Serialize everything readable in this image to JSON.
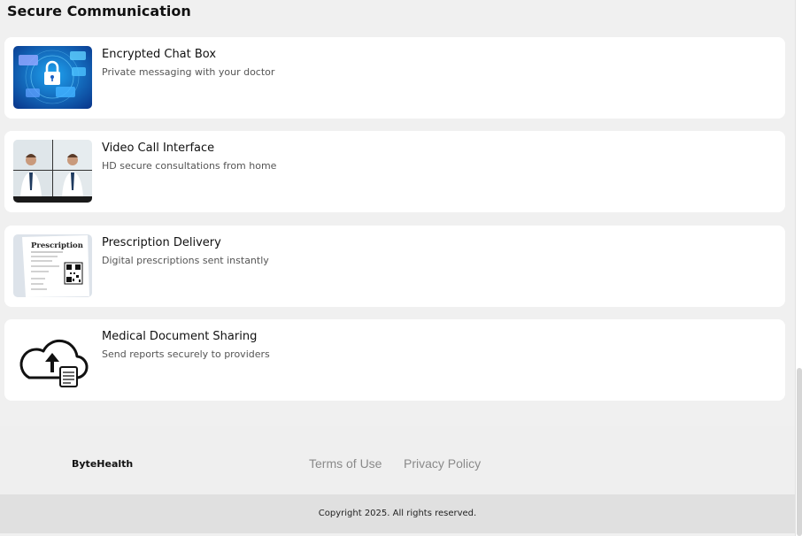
{
  "section": {
    "title": "Secure Communication"
  },
  "cards": [
    {
      "title": "Encrypted Chat Box",
      "description": "Private messaging with your doctor",
      "icon": "encrypted-chat-image"
    },
    {
      "title": "Video Call Interface",
      "description": "HD secure consultations from home",
      "icon": "video-call-image"
    },
    {
      "title": "Prescription Delivery",
      "description": "Digital prescriptions sent instantly",
      "icon": "prescription-image"
    },
    {
      "title": "Medical Document Sharing",
      "description": "Send reports securely to providers",
      "icon": "cloud-upload-icon"
    }
  ],
  "thumb_labels": {
    "prescription": "Prescription"
  },
  "footer": {
    "brand": "ByteHealth",
    "links": [
      "Terms of Use",
      "Privacy Policy"
    ],
    "copyright": "Copyright 2025. All rights reserved."
  },
  "colors": {
    "page_background": "#f0f0f0",
    "card_background": "#ffffff",
    "footer_background": "#efefef",
    "copyright_background": "#e0e0e0",
    "link_color": "#8a8a8a"
  }
}
